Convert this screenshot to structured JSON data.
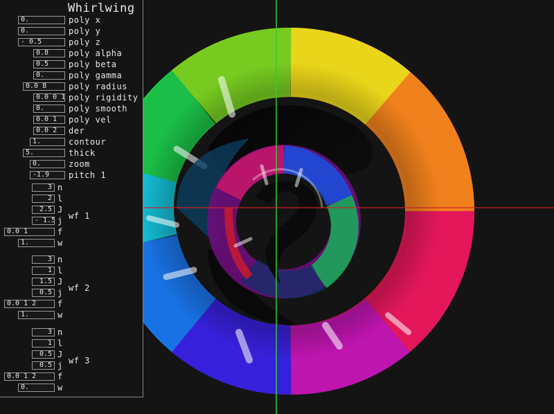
{
  "panel": {
    "title": "Whirlwing",
    "params": [
      {
        "value": "0.",
        "label": "poly x"
      },
      {
        "value": "0.",
        "label": "poly y"
      },
      {
        "value": "- 0.5",
        "label": "poly z"
      },
      {
        "value": "0.8",
        "label": "poly alpha"
      },
      {
        "value": "0.5",
        "label": "poly beta"
      },
      {
        "value": "0.",
        "label": "poly gamma"
      },
      {
        "value": "0.0 8",
        "label": "poly radius"
      },
      {
        "value": "0.0 0 1",
        "label": "poly rigidity"
      },
      {
        "value": "0.",
        "label": "poly smooth"
      },
      {
        "value": "0.0 1",
        "label": "poly vel"
      },
      {
        "value": "0.0 2",
        "label": "der"
      },
      {
        "value": "1.",
        "label": "contour"
      },
      {
        "value": "5.",
        "label": "thick"
      },
      {
        "value": "0.",
        "label": "zoom"
      },
      {
        "value": "-1.9",
        "label": "pitch 1"
      }
    ],
    "wavefunctions": [
      {
        "name": "wf 1",
        "n": {
          "label": "n",
          "value": "3"
        },
        "l": {
          "label": "l",
          "value": "2"
        },
        "J": {
          "label": "J",
          "value": "2.5"
        },
        "j": {
          "label": "j",
          "value": "- 1.5"
        },
        "f": {
          "label": "f",
          "value": "0.0 1"
        },
        "w": {
          "label": "w",
          "value": "1."
        }
      },
      {
        "name": "wf 2",
        "n": {
          "label": "n",
          "value": "3"
        },
        "l": {
          "label": "l",
          "value": "1"
        },
        "J": {
          "label": "J",
          "value": "1.5"
        },
        "j": {
          "label": "j",
          "value": "0.5"
        },
        "f": {
          "label": "f",
          "value": "0.0 1 2"
        },
        "w": {
          "label": "w",
          "value": "1."
        }
      },
      {
        "name": "wf 3",
        "n": {
          "label": "n",
          "value": "3"
        },
        "l": {
          "label": "l",
          "value": "1"
        },
        "J": {
          "label": "J",
          "value": "0.5"
        },
        "j": {
          "label": "j",
          "value": "0.5"
        },
        "f": {
          "label": "f",
          "value": "0.0 1 2"
        },
        "w": {
          "label": "w",
          "value": "0."
        }
      }
    ]
  },
  "colors": {
    "background": "#141414",
    "axis_vertical": "#33cc33",
    "axis_horizontal": "#cc2222",
    "panel_border": "#8a8a8a"
  }
}
